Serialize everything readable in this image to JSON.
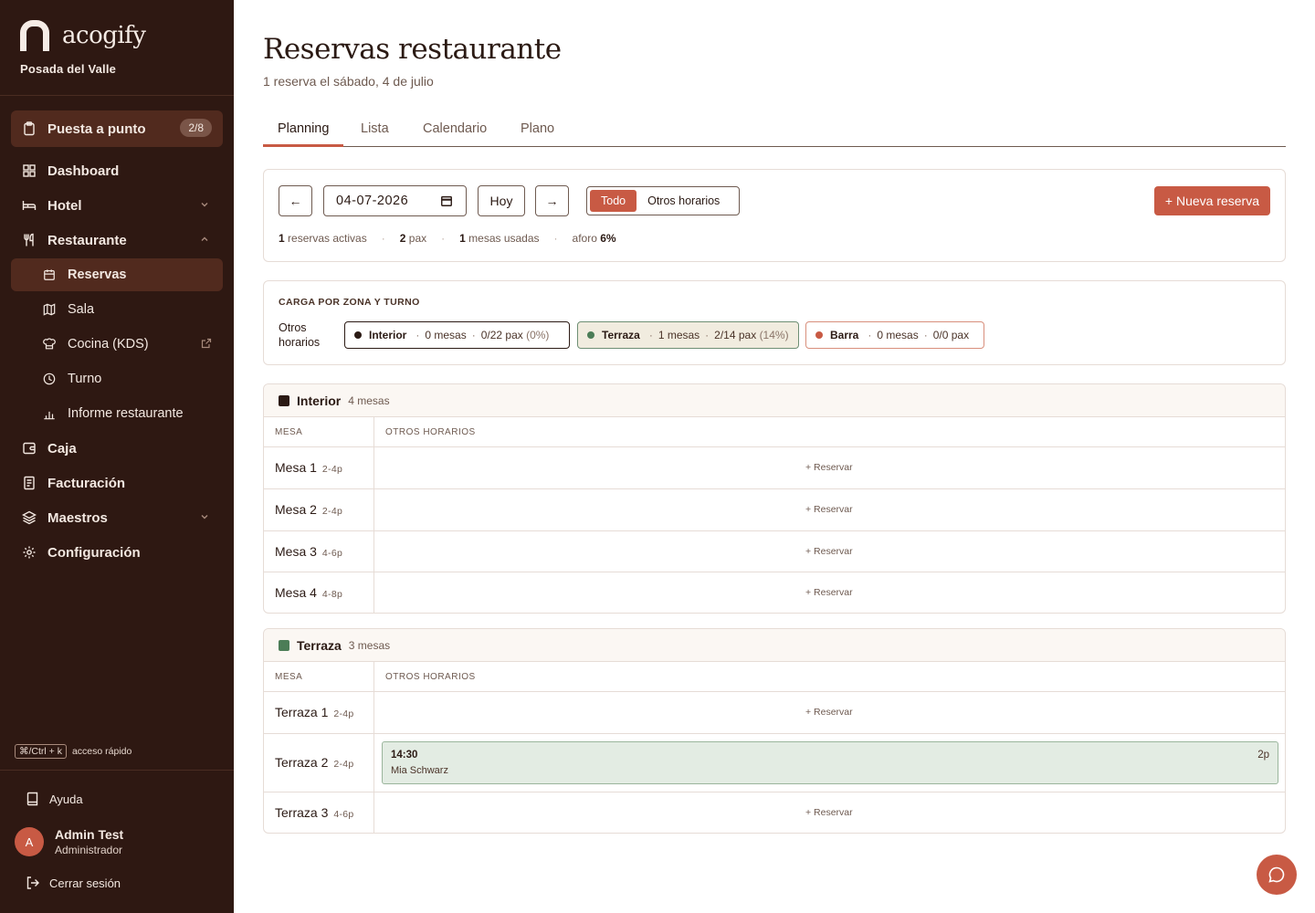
{
  "app": {
    "brand": "acogify",
    "property": "Posada del Valle"
  },
  "sidebar": {
    "setup": {
      "label": "Puesta a punto",
      "badge": "2/8",
      "icon": "clipboard-icon"
    },
    "items": [
      {
        "label": "Dashboard",
        "icon": "grid-icon"
      },
      {
        "label": "Hotel",
        "icon": "bed-icon"
      },
      {
        "label": "Restaurante",
        "icon": "utensils-icon"
      },
      {
        "label": "Reservas",
        "icon": "calendar-icon"
      },
      {
        "label": "Sala",
        "icon": "map-icon"
      },
      {
        "label": "Cocina (KDS)",
        "icon": "chef-hat-icon"
      },
      {
        "label": "Turno",
        "icon": "clock-icon"
      },
      {
        "label": "Informe restaurante",
        "icon": "bar-chart-icon"
      },
      {
        "label": "Caja",
        "icon": "wallet-icon"
      },
      {
        "label": "Facturación",
        "icon": "invoice-icon"
      },
      {
        "label": "Maestros",
        "icon": "layers-icon"
      },
      {
        "label": "Configuración",
        "icon": "gear-icon"
      }
    ],
    "shortcut": {
      "keys": "⌘/Ctrl + k",
      "label": "acceso rápido"
    },
    "help": "Ayuda",
    "user": {
      "initial": "A",
      "name": "Admin Test",
      "role": "Administrador"
    },
    "logout": "Cerrar sesión"
  },
  "header": {
    "title": "Reservas restaurante",
    "subtitle": "1 reserva el sábado, 4 de julio"
  },
  "tabs": [
    "Planning",
    "Lista",
    "Calendario",
    "Plano"
  ],
  "toolbar": {
    "prev": "←",
    "date": "04-07-2026",
    "today": "Hoy",
    "next": "→",
    "filter_all": "Todo",
    "filter_other": "Otros horarios",
    "new_booking": "+ Nueva reserva"
  },
  "stats": {
    "active_count": "1",
    "active_label": "reservas activas",
    "pax_count": "2",
    "pax_label": "pax",
    "tables_count": "1",
    "tables_label": "mesas usadas",
    "occupancy_label": "aforo",
    "occupancy_value": "6%"
  },
  "load": {
    "title": "CARGA POR ZONA Y TURNO",
    "shift": "Otros horarios",
    "zones": [
      {
        "name": "Interior",
        "tables": "0 mesas",
        "pax": "0/22 pax",
        "pct": "(0%)",
        "color": "#2b1a14"
      },
      {
        "name": "Terraza",
        "tables": "1 mesas",
        "pax": "2/14 pax",
        "pct": "(14%)",
        "color": "#4c7d57"
      },
      {
        "name": "Barra",
        "tables": "0 mesas",
        "pax": "0/0 pax",
        "pct": "",
        "color": "#c85a44"
      }
    ]
  },
  "grid": {
    "col_table": "MESA",
    "col_slot": "OTROS HORARIOS",
    "reserve_label": "+ Reservar",
    "zones": [
      {
        "name": "Interior",
        "count": "4 mesas",
        "color": "#2b1a14",
        "tables": [
          {
            "name": "Mesa 1",
            "cap": "2-4p"
          },
          {
            "name": "Mesa 2",
            "cap": "2-4p"
          },
          {
            "name": "Mesa 3",
            "cap": "4-6p"
          },
          {
            "name": "Mesa 4",
            "cap": "4-8p"
          }
        ]
      },
      {
        "name": "Terraza",
        "count": "3 mesas",
        "color": "#4c7d57",
        "tables": [
          {
            "name": "Terraza 1",
            "cap": "2-4p"
          },
          {
            "name": "Terraza 2",
            "cap": "2-4p",
            "booking": {
              "time": "14:30",
              "guest": "Mia Schwarz",
              "pax": "2p"
            }
          },
          {
            "name": "Terraza 3",
            "cap": "4-6p"
          }
        ]
      }
    ]
  },
  "chat": {
    "icon": "chat-icon"
  }
}
